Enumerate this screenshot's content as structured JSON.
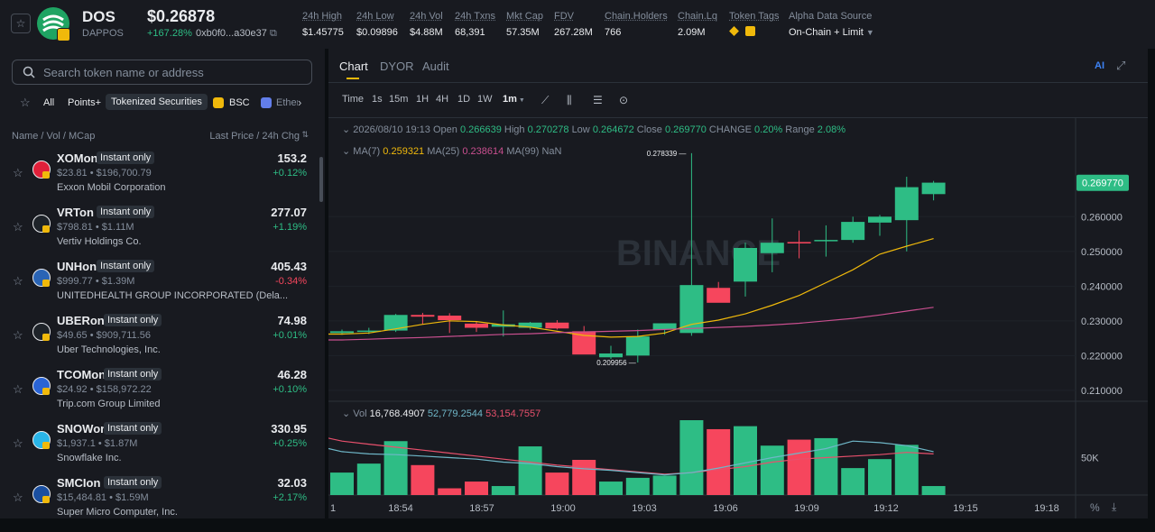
{
  "header": {
    "symbol": "DOS",
    "network": "DAPPOS",
    "price": "$0.26878",
    "change": "+167.28%",
    "address": "0xb0f0...a30e37",
    "stats": [
      {
        "label": "24h High",
        "value": "$1.45775"
      },
      {
        "label": "24h Low",
        "value": "$0.09896"
      },
      {
        "label": "24h Vol",
        "value": "$4.88M"
      },
      {
        "label": "24h Txns",
        "value": "68,391"
      },
      {
        "label": "Mkt Cap",
        "value": "57.35M"
      },
      {
        "label": "FDV",
        "value": "267.28M"
      },
      {
        "label": "Chain.Holders",
        "value": "766"
      },
      {
        "label": "Chain.Lq",
        "value": "2.09M"
      },
      {
        "label": "Token Tags",
        "value": ""
      },
      {
        "label": "Alpha Data Source",
        "value": "On-Chain + Limit"
      }
    ]
  },
  "search": {
    "placeholder": "Search token name or address"
  },
  "filters": {
    "all": "All",
    "points": "Points+",
    "tokenized": "Tokenized Securities",
    "bsc": "BSC",
    "eth": "Ether"
  },
  "columns": {
    "left": "Name / Vol / MCap",
    "right": "Last Price / 24h Chg"
  },
  "tokens": [
    {
      "symbol": "XOMon",
      "tag": "Instant only",
      "vol_mcap": "$23.81 • $196,700.79",
      "name": "Exxon Mobil Corporation",
      "price": "153.2",
      "change": "+0.12%",
      "up": true,
      "icon_color": "#e0203a"
    },
    {
      "symbol": "VRTon",
      "tag": "Instant only",
      "vol_mcap": "$798.81 • $1.11M",
      "name": "Vertiv Holdings Co.",
      "price": "277.07",
      "change": "+1.19%",
      "up": true,
      "icon_color": "#1e2329"
    },
    {
      "symbol": "UNHon",
      "tag": "Instant only",
      "vol_mcap": "$999.77 • $1.39M",
      "name": "UNITEDHEALTH GROUP INCORPORATED (Dela...",
      "price": "405.43",
      "change": "-0.34%",
      "up": false,
      "icon_color": "#2a64b5"
    },
    {
      "symbol": "UBERon",
      "tag": "Instant only",
      "vol_mcap": "$49.65 • $909,711.56",
      "name": "Uber Technologies, Inc.",
      "price": "74.98",
      "change": "+0.01%",
      "up": true,
      "icon_color": "#1e2329"
    },
    {
      "symbol": "TCOMon",
      "tag": "Instant only",
      "vol_mcap": "$24.92 • $158,972.22",
      "name": "Trip.com Group Limited",
      "price": "46.28",
      "change": "+0.10%",
      "up": true,
      "icon_color": "#2a64d5"
    },
    {
      "symbol": "SNOWon",
      "tag": "Instant only",
      "vol_mcap": "$1,937.1 • $1.87M",
      "name": "Snowflake Inc.",
      "price": "330.95",
      "change": "+0.25%",
      "up": true,
      "icon_color": "#29b5e8"
    },
    {
      "symbol": "SMCIon",
      "tag": "Instant only",
      "vol_mcap": "$15,484.81 • $1.59M",
      "name": "Super Micro Computer, Inc.",
      "price": "32.03",
      "change": "+2.17%",
      "up": true,
      "icon_color": "#1a4fa0"
    }
  ],
  "chart_tabs": [
    "Chart",
    "DYOR",
    "Audit"
  ],
  "intervals": [
    "Time",
    "1s",
    "15m",
    "1H",
    "4H",
    "1D",
    "1W",
    "1m"
  ],
  "ohlc": {
    "date": "2026/08/10 19:13",
    "open_label": "Open",
    "open": "0.266639",
    "high_label": "High",
    "high": "0.270278",
    "low_label": "Low",
    "low": "0.264672",
    "close_label": "Close",
    "close": "0.269770",
    "change_label": "CHANGE",
    "change": "0.20%",
    "range_label": "Range",
    "range": "2.08%"
  },
  "ma": {
    "ma7_label": "MA(7)",
    "ma7": "0.259321",
    "ma25_label": "MA(25)",
    "ma25": "0.238614",
    "ma99_label": "MA(99)",
    "ma99": "NaN"
  },
  "vol": {
    "label": "Vol",
    "v1": "16,768.4907",
    "v2": "52,779.2544",
    "v3": "53,154.7557"
  },
  "watermark": "BINANCE",
  "colors": {
    "up": "#2ebd85",
    "down": "#f6465d",
    "accent": "#f0b90b",
    "ma7": "#f0b90b",
    "ma25": "#c94f8f",
    "vol_ma1": "#e8506c",
    "vol_ma2": "#6fb7c8"
  },
  "chart_data": {
    "type": "candlestick",
    "x_tick_labels": [
      "1",
      "18:54",
      "18:57",
      "19:00",
      "19:03",
      "19:06",
      "19:09",
      "19:12",
      "19:15",
      "19:18"
    ],
    "y_tick_labels": [
      "0.260000",
      "0.250000",
      "0.240000",
      "0.230000",
      "0.220000",
      "0.210000"
    ],
    "ylim": [
      0.2058,
      0.278
    ],
    "last_price_label": "0.269770",
    "high_marker": "0.278339",
    "low_marker": "0.209956",
    "candles": [
      {
        "o": 0.2265,
        "h": 0.2275,
        "l": 0.226,
        "c": 0.227
      },
      {
        "o": 0.227,
        "h": 0.228,
        "l": 0.2262,
        "c": 0.2272
      },
      {
        "o": 0.2272,
        "h": 0.232,
        "l": 0.2268,
        "c": 0.2317
      },
      {
        "o": 0.2317,
        "h": 0.2323,
        "l": 0.229,
        "c": 0.2312
      },
      {
        "o": 0.2315,
        "h": 0.2322,
        "l": 0.2265,
        "c": 0.2302
      },
      {
        "o": 0.2292,
        "h": 0.2298,
        "l": 0.2268,
        "c": 0.228
      },
      {
        "o": 0.2283,
        "h": 0.233,
        "l": 0.2255,
        "c": 0.229
      },
      {
        "o": 0.228,
        "h": 0.2297,
        "l": 0.2275,
        "c": 0.2295
      },
      {
        "o": 0.2295,
        "h": 0.2302,
        "l": 0.2275,
        "c": 0.2278
      },
      {
        "o": 0.227,
        "h": 0.2285,
        "l": 0.221,
        "c": 0.2203
      },
      {
        "o": 0.2195,
        "h": 0.2228,
        "l": 0.219,
        "c": 0.2206
      },
      {
        "o": 0.22,
        "h": 0.2275,
        "l": 0.218,
        "c": 0.2255
      },
      {
        "o": 0.2275,
        "h": 0.2292,
        "l": 0.226,
        "c": 0.2293
      },
      {
        "o": 0.2265,
        "h": 0.2783,
        "l": 0.2257,
        "c": 0.2403
      },
      {
        "o": 0.2395,
        "h": 0.2412,
        "l": 0.237,
        "c": 0.2352
      },
      {
        "o": 0.2413,
        "h": 0.2525,
        "l": 0.237,
        "c": 0.251
      },
      {
        "o": 0.2495,
        "h": 0.2595,
        "l": 0.244,
        "c": 0.2525
      },
      {
        "o": 0.2527,
        "h": 0.256,
        "l": 0.248,
        "c": 0.2523
      },
      {
        "o": 0.253,
        "h": 0.2575,
        "l": 0.2485,
        "c": 0.2533
      },
      {
        "o": 0.2533,
        "h": 0.26,
        "l": 0.2525,
        "c": 0.2585
      },
      {
        "o": 0.2583,
        "h": 0.2605,
        "l": 0.2545,
        "c": 0.26
      },
      {
        "o": 0.259,
        "h": 0.2715,
        "l": 0.25,
        "c": 0.2685
      },
      {
        "o": 0.2665,
        "h": 0.2703,
        "l": 0.2647,
        "c": 0.2698
      }
    ],
    "ma7": [
      0.2262,
      0.2265,
      0.2277,
      0.229,
      0.23,
      0.2298,
      0.2288,
      0.2282,
      0.227,
      0.2258,
      0.2253,
      0.2255,
      0.2265,
      0.229,
      0.2302,
      0.232,
      0.2345,
      0.2373,
      0.241,
      0.2447,
      0.2492,
      0.2515,
      0.2537
    ],
    "ma25": [
      0.2245,
      0.2247,
      0.225,
      0.2252,
      0.2255,
      0.2258,
      0.2261,
      0.2263,
      0.2266,
      0.2268,
      0.227,
      0.2272,
      0.2275,
      0.2278,
      0.2281,
      0.2284,
      0.2288,
      0.2293,
      0.23,
      0.2307,
      0.2317,
      0.2328,
      0.2339
    ],
    "volumes": [
      0.3,
      0.42,
      0.72,
      0.4,
      0.09,
      0.18,
      0.12,
      0.65,
      0.3,
      0.47,
      0.18,
      0.23,
      0.26,
      1.0,
      0.88,
      0.92,
      0.66,
      0.74,
      0.76,
      0.36,
      0.48,
      0.67,
      0.12
    ],
    "vol_ytick": "50K",
    "vol_ma1": [
      0.72,
      0.68,
      0.64,
      0.6,
      0.56,
      0.52,
      0.48,
      0.44,
      0.4,
      0.37,
      0.34,
      0.31,
      0.28,
      0.3,
      0.34,
      0.38,
      0.44,
      0.48,
      0.5,
      0.52,
      0.54,
      0.57,
      0.55
    ],
    "vol_ma2": [
      0.58,
      0.55,
      0.54,
      0.52,
      0.5,
      0.48,
      0.44,
      0.42,
      0.38,
      0.35,
      0.33,
      0.3,
      0.27,
      0.3,
      0.36,
      0.43,
      0.5,
      0.56,
      0.62,
      0.72,
      0.7,
      0.66,
      0.58
    ]
  }
}
